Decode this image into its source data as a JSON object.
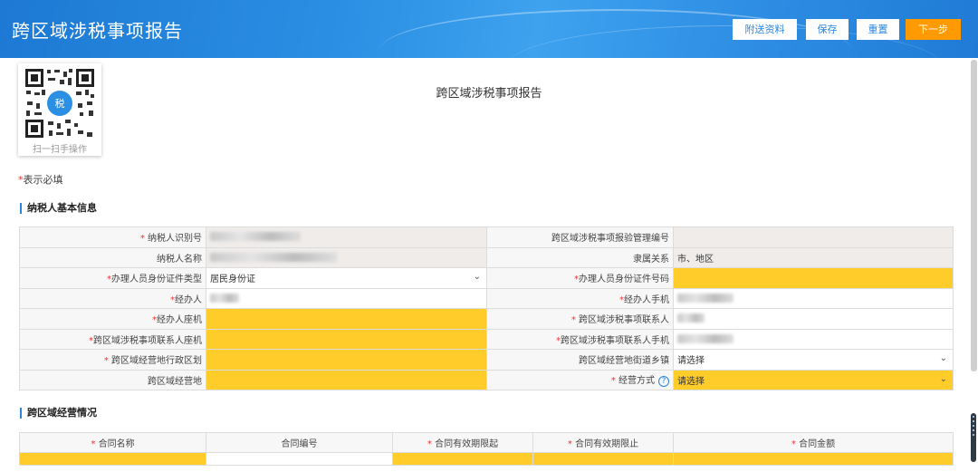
{
  "header": {
    "title": "跨区域涉税事项报告",
    "buttons": {
      "attach": "附送资料",
      "save": "保存",
      "reset": "重置",
      "next": "下一步"
    }
  },
  "qr": {
    "caption": "扫一扫手操作"
  },
  "doc_title": "跨区域涉税事项报告",
  "required_note": "表示必填",
  "section_basic": "纳税人基本信息",
  "section_business": "跨区域经营情况",
  "form": {
    "taxpayer_id_label": "纳税人识别号",
    "report_no_label": "跨区域涉税事项报验管理编号",
    "taxpayer_name_label": "纳税人名称",
    "affiliation_label": "隶属关系",
    "affiliation_value": "市、地区",
    "id_type_label": "办理人员身份证件类型",
    "id_type_value": "居民身份证",
    "id_no_label": "办理人员身份证件号码",
    "handler_label": "经办人",
    "handler_mobile_label": "经办人手机",
    "handler_phone_label": "经办人座机",
    "contact_label": "跨区域涉税事项联系人",
    "contact_phone_label": "跨区域涉税事项联系人座机",
    "contact_mobile_label": "跨区域涉税事项联系人手机",
    "region_label": "跨区域经营地行政区划",
    "street_label": "跨区域经营地街道乡镇",
    "street_value": "请选择",
    "address_label": "跨区域经营地",
    "mode_label": "经营方式",
    "mode_value": "请选择"
  },
  "contract": {
    "headers": [
      "合同名称",
      "合同编号",
      "合同有效期限起",
      "合同有效期限止",
      "合同金额"
    ]
  },
  "icons": {
    "dropdown": "chevron-down-icon",
    "help": "question-circle-icon"
  },
  "colors": {
    "header_blue": "#2b8fe3",
    "next_button": "#ff9a00",
    "required_field": "#ffcc29",
    "required_star": "#e33333"
  }
}
